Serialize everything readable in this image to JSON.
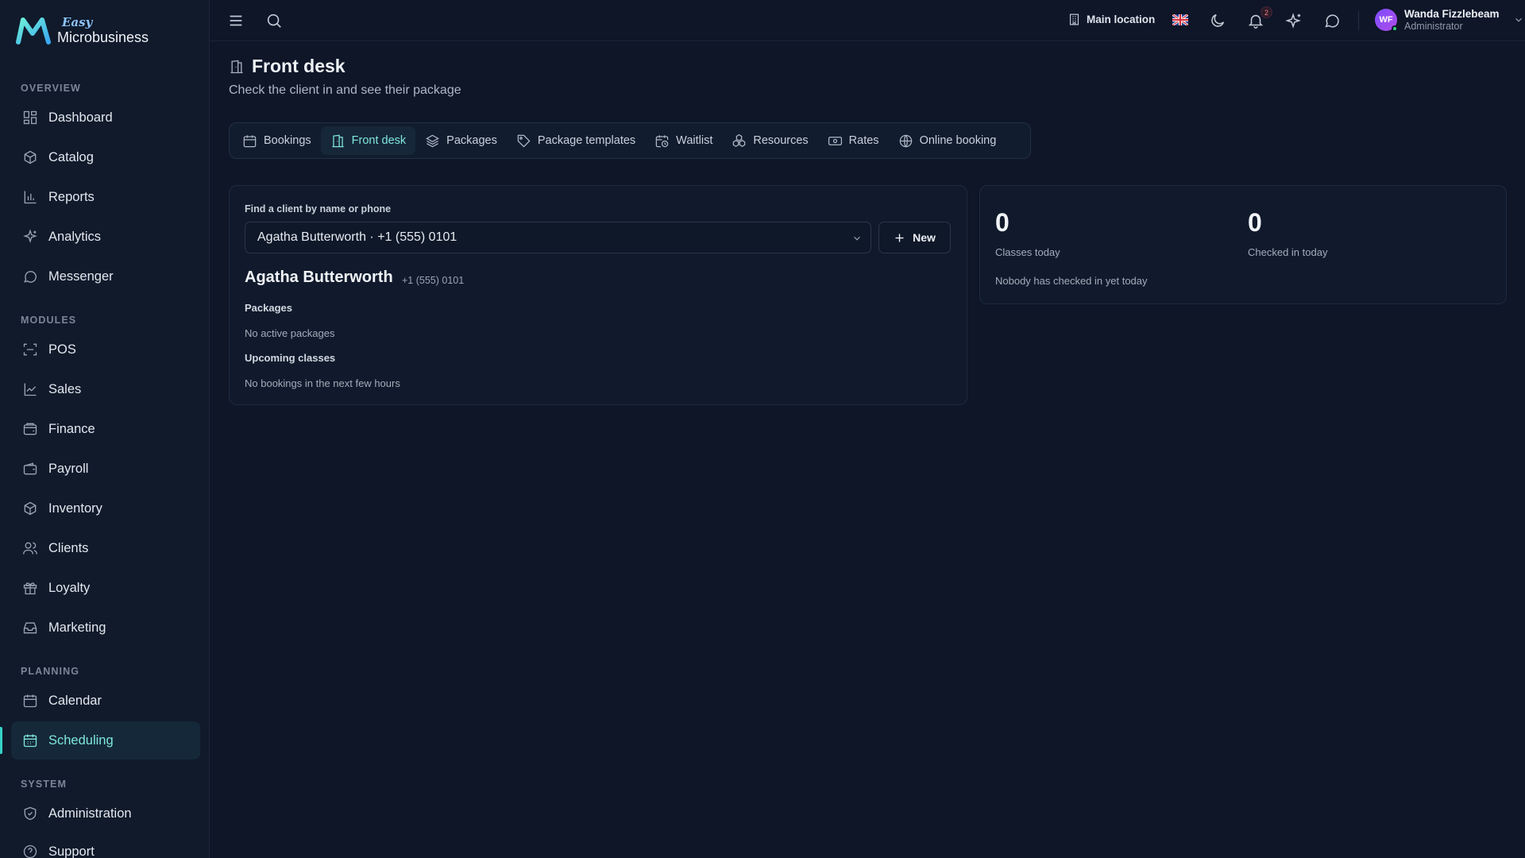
{
  "brand": {
    "easy": "Easy",
    "name": "Microbusiness"
  },
  "sidebar": {
    "sections": {
      "overview": "OVERVIEW",
      "modules": "MODULES",
      "planning": "PLANNING",
      "system": "SYSTEM"
    },
    "items": {
      "dashboard": "Dashboard",
      "catalog": "Catalog",
      "reports": "Reports",
      "analytics": "Analytics",
      "messenger": "Messenger",
      "pos": "POS",
      "sales": "Sales",
      "finance": "Finance",
      "payroll": "Payroll",
      "inventory": "Inventory",
      "clients": "Clients",
      "loyalty": "Loyalty",
      "marketing": "Marketing",
      "calendar": "Calendar",
      "scheduling": "Scheduling",
      "administration": "Administration",
      "support": "Support"
    },
    "active": "scheduling"
  },
  "topbar": {
    "location": "Main location",
    "notifications_count": "2",
    "user": {
      "initials": "WF",
      "name": "Wanda Fizzlebeam",
      "role": "Administrator"
    }
  },
  "page": {
    "title": "Front desk",
    "subtitle": "Check the client in and see their package"
  },
  "tabs": {
    "bookings": "Bookings",
    "front_desk": "Front desk",
    "packages": "Packages",
    "package_templates": "Package templates",
    "waitlist": "Waitlist",
    "resources": "Resources",
    "rates": "Rates",
    "online_booking": "Online booking",
    "active": "front_desk"
  },
  "client_panel": {
    "search_label": "Find a client by name or phone",
    "selected": "Agatha Butterworth · +1 (555) 0101",
    "new_button": "New",
    "client_name": "Agatha Butterworth",
    "client_phone": "+1 (555) 0101",
    "packages_heading": "Packages",
    "packages_empty": "No active packages",
    "upcoming_heading": "Upcoming classes",
    "upcoming_empty": "No bookings in the next few hours"
  },
  "stats": {
    "classes_today": "0",
    "classes_today_label": "Classes today",
    "checked_in": "0",
    "checked_in_label": "Checked in today",
    "note": "Nobody has checked in yet today"
  },
  "colors": {
    "background": "#0e1628",
    "sidebar": "#101a2b",
    "accent": "#7fe7df",
    "active_indicator": "#37d3c6"
  }
}
